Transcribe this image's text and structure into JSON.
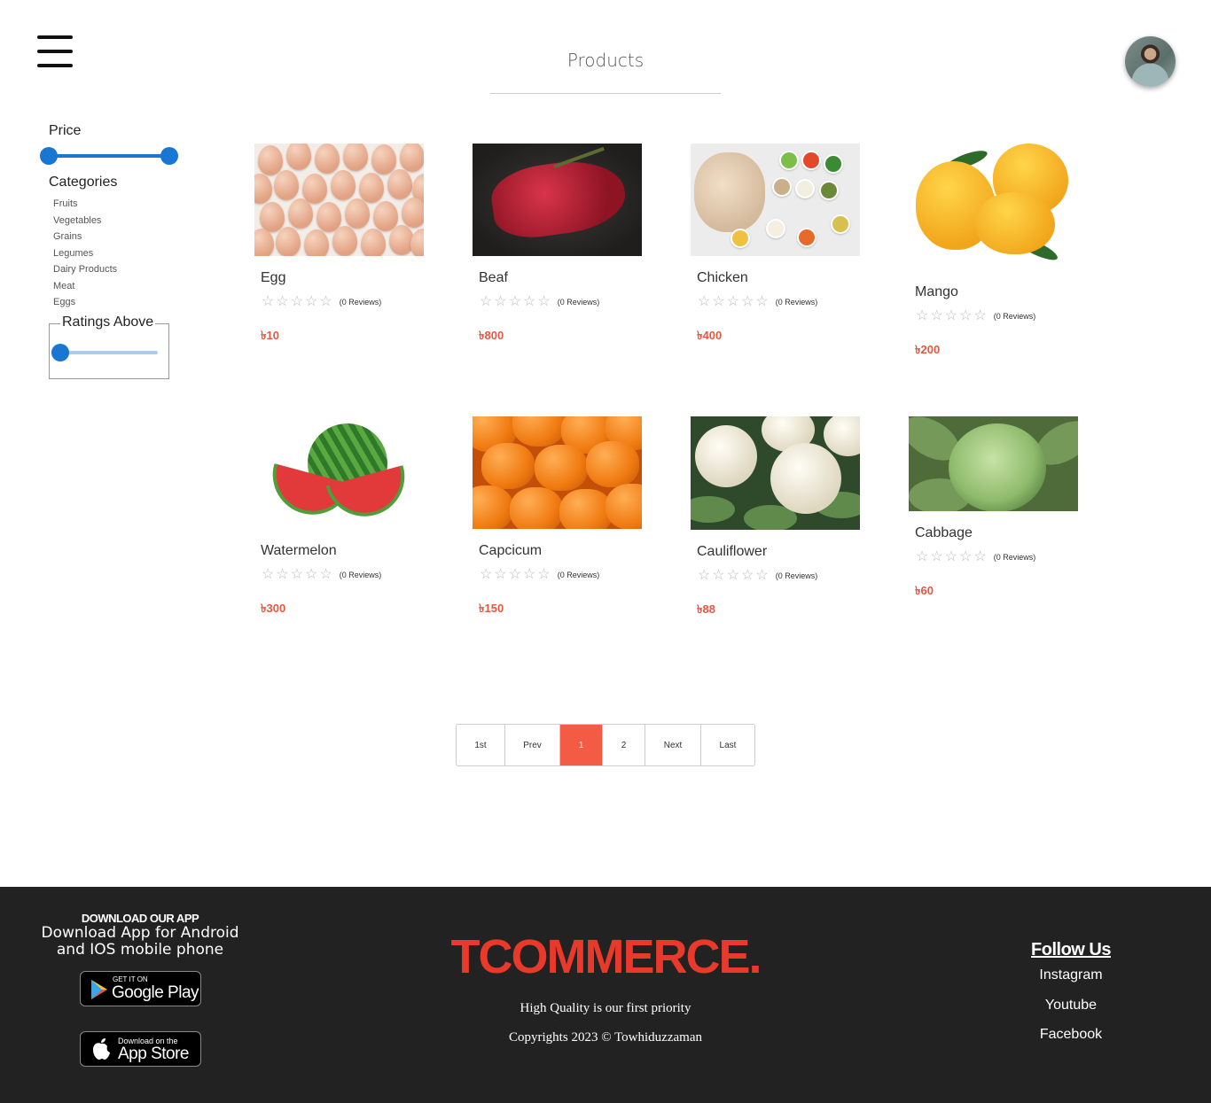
{
  "header": {
    "title": "Products"
  },
  "filters": {
    "price_label": "Price",
    "categories_label": "Categories",
    "categories": [
      "Fruits",
      "Vegetables",
      "Grains",
      "Legumes",
      "Dairy Products",
      "Meat",
      "Eggs"
    ],
    "ratings_label": "Ratings Above",
    "price_range_fraction": [
      0,
      1
    ],
    "rating_value": 0
  },
  "currency": "৳",
  "products": [
    {
      "name": "Egg",
      "reviews": "(0 Reviews)",
      "price": "10",
      "rating": 0
    },
    {
      "name": "Beaf",
      "reviews": "(0 Reviews)",
      "price": "800",
      "rating": 0
    },
    {
      "name": "Chicken",
      "reviews": "(0 Reviews)",
      "price": "400",
      "rating": 0
    },
    {
      "name": "Mango",
      "reviews": "(0 Reviews)",
      "price": "200",
      "rating": 0
    },
    {
      "name": "Watermelon",
      "reviews": "(0 Reviews)",
      "price": "300",
      "rating": 0
    },
    {
      "name": "Capcicum",
      "reviews": "(0 Reviews)",
      "price": "150",
      "rating": 0
    },
    {
      "name": "Cauliflower",
      "reviews": "(0 Reviews)",
      "price": "88",
      "rating": 0
    },
    {
      "name": "Cabbage",
      "reviews": "(0 Reviews)",
      "price": "60",
      "rating": 0
    }
  ],
  "pagination": {
    "first": "1st",
    "prev": "Prev",
    "pages": [
      "1",
      "2"
    ],
    "current": "1",
    "next": "Next",
    "last": "Last"
  },
  "footer": {
    "download_heading": "DOWNLOAD OUR APP",
    "download_text": "Download App for Android and IOS mobile phone",
    "google_play": {
      "small": "GET IT ON",
      "big": "Google Play"
    },
    "app_store": {
      "small": "Download on the",
      "big": "App Store"
    },
    "brand": "TCOMMERCE.",
    "tagline": "High Quality is our first priority",
    "copyright": "Copyrights 2023 © Towhiduzzaman",
    "follow_heading": "Follow Us",
    "social": [
      "Instagram",
      "Youtube",
      "Facebook"
    ]
  },
  "colors": {
    "accent": "#f35b45",
    "price": "#e8563f",
    "slider": "#1976d2",
    "brand": "#e8392a",
    "footer_bg": "#222222"
  }
}
